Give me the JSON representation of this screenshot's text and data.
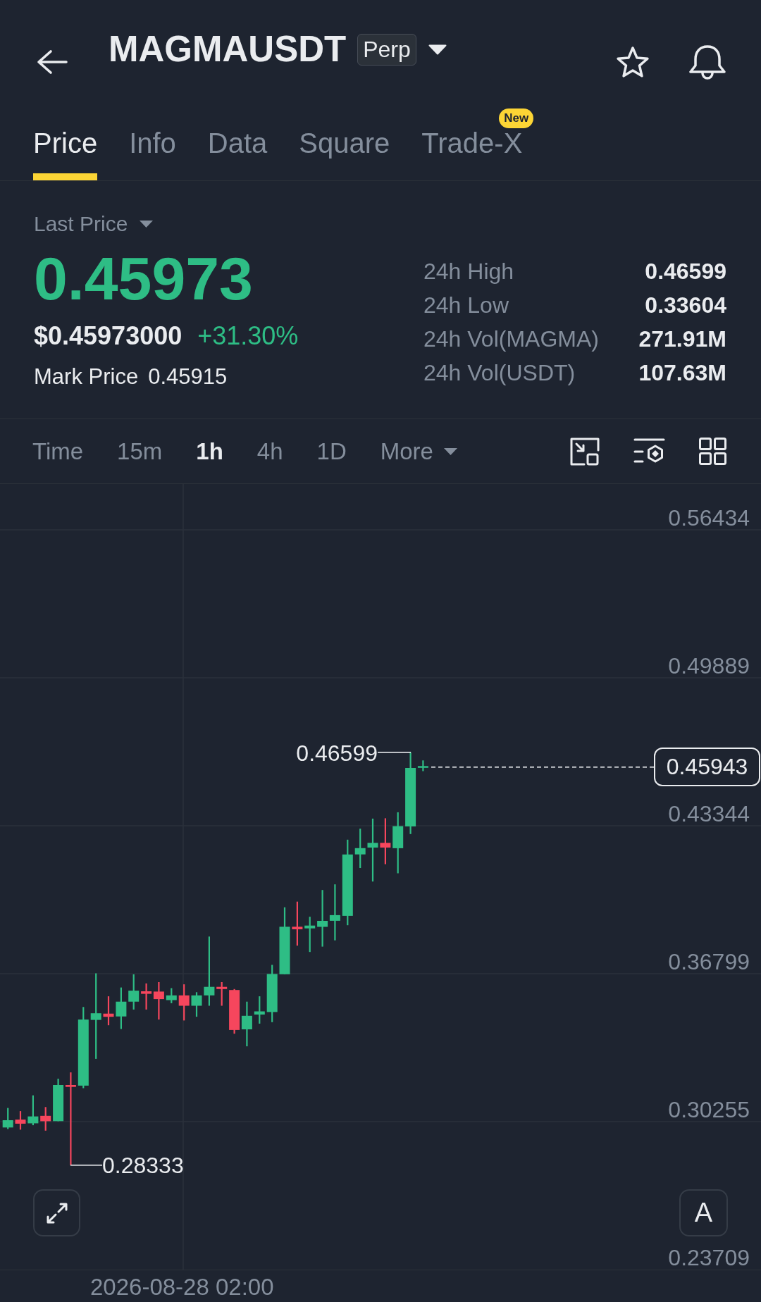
{
  "header": {
    "symbol": "MAGMAUSDT",
    "contract_type": "Perp"
  },
  "tabs": [
    {
      "label": "Price",
      "selected": true
    },
    {
      "label": "Info",
      "selected": false
    },
    {
      "label": "Data",
      "selected": false
    },
    {
      "label": "Square",
      "selected": false
    },
    {
      "label": "Trade-X",
      "selected": false,
      "badge": "New"
    }
  ],
  "ticker": {
    "price_type": "Last Price",
    "last_price": "0.45973",
    "usd_price": "$0.45973000",
    "change": "+31.30%",
    "mark_price_label": "Mark Price",
    "mark_price": "0.45915",
    "stats": [
      {
        "label": "24h High",
        "value": "0.46599"
      },
      {
        "label": "24h Low",
        "value": "0.33604"
      },
      {
        "label": "24h Vol(MAGMA)",
        "value": "271.91M"
      },
      {
        "label": "24h Vol(USDT)",
        "value": "107.63M"
      }
    ]
  },
  "intervals": [
    {
      "label": "Time",
      "kind": "option",
      "selected": false
    },
    {
      "label": "15m",
      "kind": "option",
      "selected": false
    },
    {
      "label": "1h",
      "kind": "option",
      "selected": true
    },
    {
      "label": "4h",
      "kind": "option",
      "selected": false
    },
    {
      "label": "1D",
      "kind": "option",
      "selected": false
    },
    {
      "label": "More",
      "kind": "menu",
      "selected": false
    }
  ],
  "chart": {
    "price_axis": [
      "0.56434",
      "0.49889",
      "0.43344",
      "0.36799",
      "0.30255",
      "0.23709"
    ],
    "high_label": "0.46599",
    "low_label": "0.28333",
    "current_price": "0.45943",
    "scale_button": "A",
    "time_axis": [
      "2026-08-28 02:00"
    ]
  }
}
